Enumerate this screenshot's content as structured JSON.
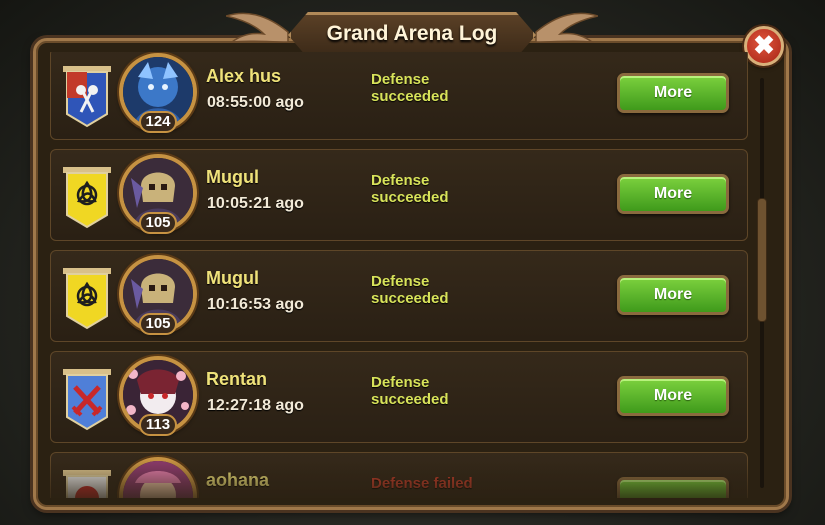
{
  "window": {
    "title": "Grand Arena Log",
    "close_icon": "close-icon",
    "close_glyph": "✖"
  },
  "entries": [
    {
      "name": "Alex hus",
      "time": "08:55:00 ago",
      "level": "124",
      "status_line1": "Defense",
      "status_line2": "succeeded",
      "more_label": "More",
      "banner_color": "#2f55b8",
      "banner_emblem": "axe-emblem-icon",
      "avatar": "blue-dragon-hero-avatar"
    },
    {
      "name": "Mugul",
      "time": "10:05:21 ago",
      "level": "105",
      "status_line1": "Defense",
      "status_line2": "succeeded",
      "more_label": "More",
      "banner_color": "#f0d723",
      "banner_emblem": "triquetra-emblem-icon",
      "avatar": "skull-knight-hero-avatar"
    },
    {
      "name": "Mugul",
      "time": "10:16:53 ago",
      "level": "105",
      "status_line1": "Defense",
      "status_line2": "succeeded",
      "more_label": "More",
      "banner_color": "#f0d723",
      "banner_emblem": "triquetra-emblem-icon",
      "avatar": "skull-knight-hero-avatar"
    },
    {
      "name": "Rentan",
      "time": "12:27:18 ago",
      "level": "113",
      "status_line1": "Defense",
      "status_line2": "succeeded",
      "more_label": "More",
      "banner_color": "#4f7fd8",
      "banner_emblem": "crossed-swords-emblem-icon",
      "avatar": "kitsune-mask-hero-avatar"
    },
    {
      "name": "aohana",
      "time": "",
      "level": "",
      "status_line1": "Defense failed",
      "status_line2": "",
      "more_label": "",
      "banner_color": "#e9e9e9",
      "banner_emblem": "red-circle-emblem-icon",
      "avatar": "pink-hero-avatar"
    }
  ],
  "colors": {
    "accent_gold": "#c69242",
    "status_success": "#d8e35a",
    "status_failed": "#c23d2a",
    "button_green": "#5cb32a"
  }
}
